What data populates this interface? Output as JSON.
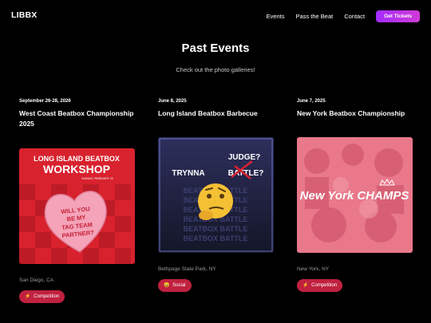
{
  "nav": {
    "logo": "LIBBX",
    "links": [
      "Events",
      "Pass the Beat",
      "Contact"
    ],
    "cta": "Get Tickets"
  },
  "page": {
    "title": "Past Events",
    "subtitle": "Check out the photo galleries!"
  },
  "events": [
    {
      "date": "September 26-28, 2026",
      "name": "West Coast Beatbox Championship 2025",
      "location": "San Diego, CA",
      "tag": "Competition",
      "tag_icon": "⚡",
      "image": {
        "headline_line1": "LONG ISLAND BEATBOX",
        "headline_line2": "WORKSHOP",
        "date_line": "SUNDAY, FEBRUARY 22",
        "heart_lines": [
          "WILL YOU",
          "BE MY",
          "TAG TEAM",
          "PARTNER?"
        ]
      }
    },
    {
      "date": "June 8, 2025",
      "name": "Long Island Beatbox Barbecue",
      "location": "Bethpage State Park, NY",
      "tag": "Social",
      "tag_icon": "😀",
      "image": {
        "word_top": "JUDGE?",
        "word_left": "TRYNNA",
        "word_strike": "BATTLE?",
        "repeat": "BEATBOX BATTLE"
      }
    },
    {
      "date": "June 7, 2025",
      "name": "New York Beatbox Championship",
      "location": "New York, NY",
      "tag": "Competition",
      "tag_icon": "⚡",
      "image": {
        "caption": "New York CHAMPS"
      }
    }
  ],
  "colors": {
    "background": "#000000",
    "tag": "#c0213f",
    "cta_start": "#a32cff",
    "cta_end": "#d13ad6"
  }
}
